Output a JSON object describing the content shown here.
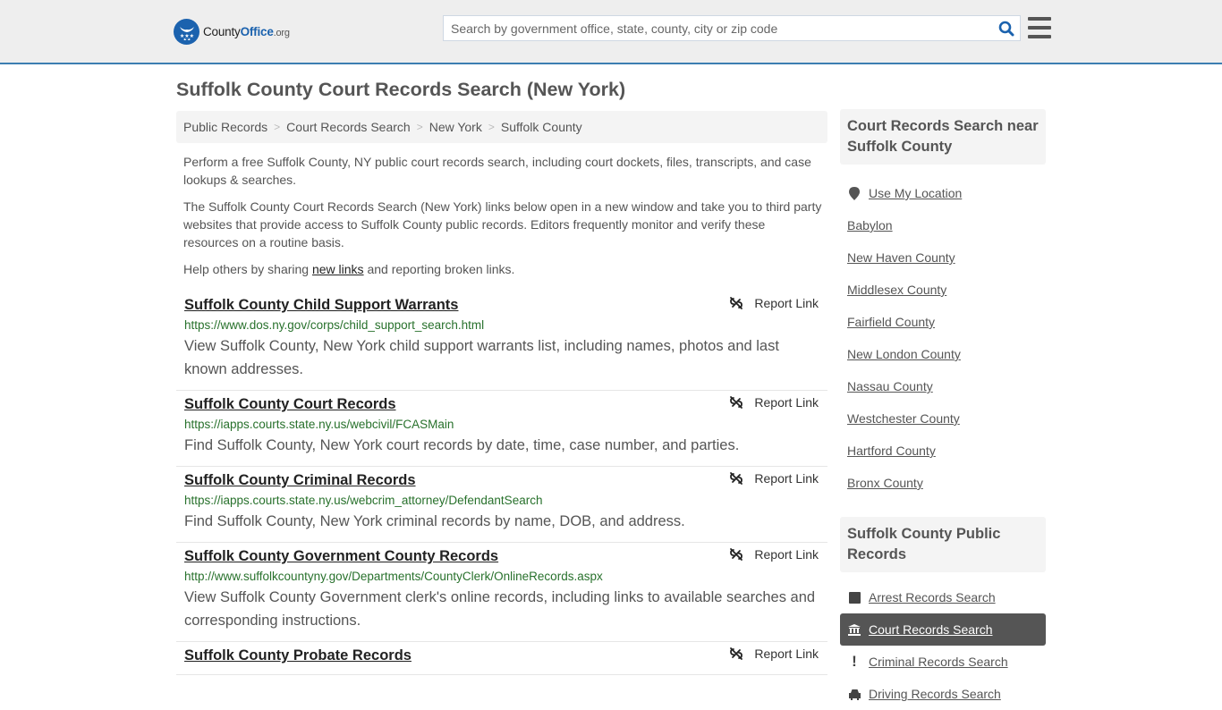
{
  "header": {
    "logo": {
      "name_plain": "County",
      "name_brand": "Office",
      "tld": ".org"
    },
    "search": {
      "placeholder": "Search by government office, state, county, city or zip code",
      "value": ""
    },
    "icons": {
      "search": "search-icon",
      "menu": "hamburger-menu-icon"
    }
  },
  "page": {
    "title": "Suffolk County Court Records Search (New York)",
    "breadcrumb": [
      "Public Records",
      "Court Records Search",
      "New York",
      "Suffolk County"
    ],
    "intro": {
      "p1": "Perform a free Suffolk County, NY public court records search, including court dockets, files, transcripts, and case lookups & searches.",
      "p2": "The Suffolk County Court Records Search (New York) links below open in a new window and take you to third party websites that provide access to Suffolk County public records. Editors frequently monitor and verify these resources on a routine basis.",
      "p3_before": "Help others by sharing ",
      "p3_link": "new links",
      "p3_after": " and reporting broken links."
    }
  },
  "results": [
    {
      "title": "Suffolk County Child Support Warrants",
      "url": "https://www.dos.ny.gov/corps/child_support_search.html",
      "description": "View Suffolk County, New York child support warrants list, including names, photos and last known addresses.",
      "report_label": "Report Link"
    },
    {
      "title": "Suffolk County Court Records",
      "url": "https://iapps.courts.state.ny.us/webcivil/FCASMain",
      "description": "Find Suffolk County, New York court records by date, time, case number, and parties.",
      "report_label": "Report Link"
    },
    {
      "title": "Suffolk County Criminal Records",
      "url": "https://iapps.courts.state.ny.us/webcrim_attorney/DefendantSearch",
      "description": "Find Suffolk County, New York criminal records by name, DOB, and address.",
      "report_label": "Report Link"
    },
    {
      "title": "Suffolk County Government County Records",
      "url": "http://www.suffolkcountyny.gov/Departments/CountyClerk/OnlineRecords.aspx",
      "description": "View Suffolk County Government clerk's online records, including links to available searches and corresponding instructions.",
      "report_label": "Report Link"
    },
    {
      "title": "Suffolk County Probate Records",
      "url": "",
      "description": "",
      "report_label": "Report Link"
    }
  ],
  "sidebar": {
    "nearby": {
      "heading": "Court Records Search near Suffolk County",
      "use_location": "Use My Location",
      "items": [
        "Babylon",
        "New Haven County",
        "Middlesex County",
        "Fairfield County",
        "New London County",
        "Nassau County",
        "Westchester County",
        "Hartford County",
        "Bronx County"
      ]
    },
    "public_records": {
      "heading": "Suffolk County Public Records",
      "items": [
        {
          "label": "Arrest Records Search",
          "icon": "square-icon",
          "active": false
        },
        {
          "label": "Court Records Search",
          "icon": "courthouse-icon",
          "active": true
        },
        {
          "label": "Criminal Records Search",
          "icon": "exclamation-icon",
          "active": false
        },
        {
          "label": "Driving Records Search",
          "icon": "car-icon",
          "active": false
        }
      ]
    }
  },
  "colors": {
    "header_bg": "#eeeeee",
    "header_border": "#3c7eb1",
    "brand_blue": "#1b62ae",
    "url_green": "#28712c",
    "active_item_bg": "#555555"
  }
}
